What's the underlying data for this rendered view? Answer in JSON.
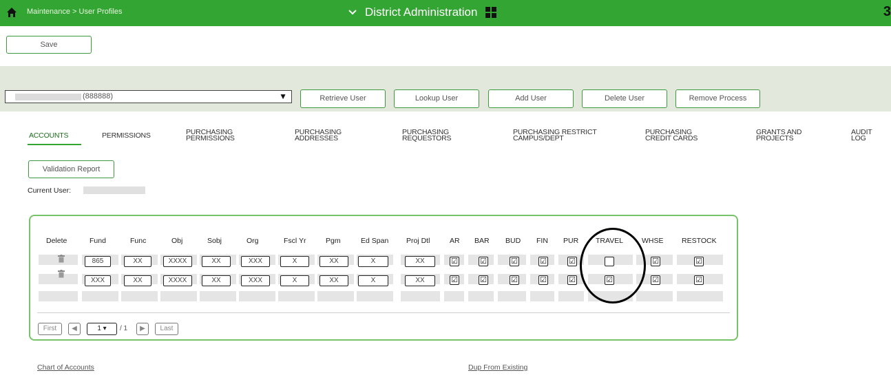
{
  "topbar": {
    "breadcrumb": "Maintenance > User Profiles",
    "app_title": "District Administration",
    "right_glyph": "3",
    "color": "#33a532"
  },
  "toolbar": {
    "save_label": "Save"
  },
  "user_band": {
    "user_id": "(888888)",
    "buttons": {
      "retrieve": "Retrieve User",
      "lookup": "Lookup User",
      "add": "Add User",
      "delete": "Delete User",
      "remove": "Remove Process"
    }
  },
  "tabs": {
    "accounts": "ACCOUNTS",
    "permissions": "PERMISSIONS",
    "purchasing_permissions_1": "PURCHASING",
    "purchasing_permissions_2": "PERMISSIONS",
    "purchasing_addresses_1": "PURCHASING",
    "purchasing_addresses_2": "ADDRESSES",
    "purchasing_requestors_1": "PURCHASING",
    "purchasing_requestors_2": "REQUESTORS",
    "purchasing_restrict_1": "PURCHASING RESTRICT",
    "purchasing_restrict_2": "CAMPUS/DEPT",
    "purchasing_cards_1": "PURCHASING",
    "purchasing_cards_2": "CREDIT CARDS",
    "grants_1": "GRANTS AND",
    "grants_2": "PROJECTS",
    "audit_1": "AUDIT",
    "audit_2": "LOG"
  },
  "validation_report": "Validation Report",
  "current_user_label": "Current User:",
  "grid": {
    "headers": {
      "delete": "Delete",
      "fund": "Fund",
      "func": "Func",
      "obj": "Obj",
      "sobj": "Sobj",
      "org": "Org",
      "fscl_yr": "Fscl Yr",
      "pgm": "Pgm",
      "ed_span": "Ed Span",
      "proj_dtl": "Proj Dtl",
      "ar": "AR",
      "bar": "BAR",
      "bud": "BUD",
      "fin": "FIN",
      "pur": "PUR",
      "travel": "TRAVEL",
      "whse": "WHSE",
      "restock": "RESTOCK"
    },
    "rows": [
      {
        "fund": "865",
        "func": "XX",
        "obj": "XXXX",
        "sobj": "XX",
        "org": "XXX",
        "fscl_yr": "X",
        "pgm": "XX",
        "ed_span": "X",
        "proj_dtl": "XX",
        "ar": "☑",
        "bar": "☑",
        "bud": "☑",
        "fin": "☑",
        "pur": "☑",
        "travel": "",
        "whse": "☑",
        "restock": "☑"
      },
      {
        "fund": "XXX",
        "func": "XX",
        "obj": "XXXX",
        "sobj": "XX",
        "org": "XXX",
        "fscl_yr": "X",
        "pgm": "XX",
        "ed_span": "X",
        "proj_dtl": "XX",
        "ar": "☑",
        "bar": "☑",
        "bud": "☑",
        "fin": "☑",
        "pur": "☑",
        "travel": "☑",
        "whse": "☑",
        "restock": "☑"
      }
    ]
  },
  "pager": {
    "first": "First",
    "prev": "◀",
    "page": "1",
    "of": "/ 1",
    "next": "▶",
    "last": "Last"
  },
  "footer": {
    "chart_of_accounts": "Chart of Accounts",
    "dup_from_existing": "Dup From Existing"
  }
}
